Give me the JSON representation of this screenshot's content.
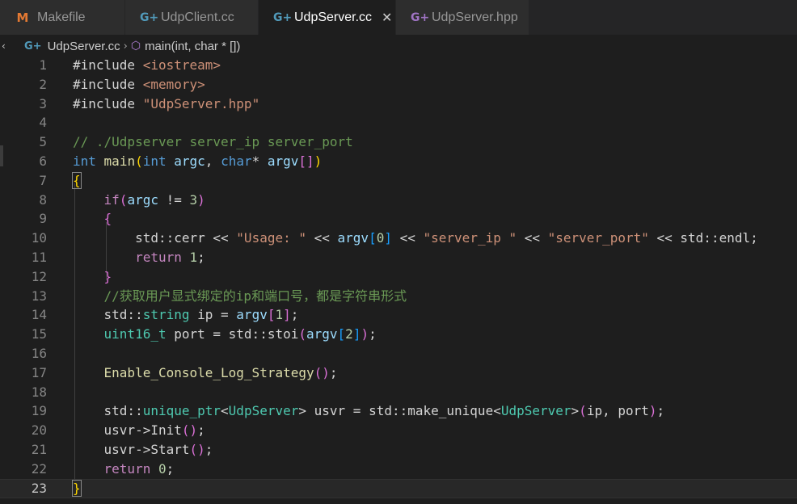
{
  "tabs": [
    {
      "label": "Makefile",
      "icon": "makefile-icon",
      "glyph": "M",
      "active": false
    },
    {
      "label": "UdpClient.cc",
      "icon": "cpp-file-icon",
      "glyph": "G+",
      "active": false
    },
    {
      "label": "UdpServer.cc",
      "icon": "cpp-file-icon",
      "glyph": "G+",
      "active": true
    },
    {
      "label": "UdpServer.hpp",
      "icon": "hpp-file-icon",
      "glyph": "G+",
      "active": false
    }
  ],
  "tab_close_glyph": "✕",
  "breadcrumb": {
    "file": "UdpServer.cc",
    "file_glyph": "G+",
    "separator": "›",
    "symbol": "main(int, char * [])",
    "symbol_glyph": "⬡"
  },
  "editor": {
    "current_line": 23,
    "lines": [
      {
        "n": 1,
        "segs": [
          [
            "pl",
            "#include "
          ],
          [
            "str",
            "<iostream>"
          ]
        ]
      },
      {
        "n": 2,
        "segs": [
          [
            "pl",
            "#include "
          ],
          [
            "str",
            "<memory>"
          ]
        ]
      },
      {
        "n": 3,
        "segs": [
          [
            "pl",
            "#include "
          ],
          [
            "str",
            "\"UdpServer.hpp\""
          ]
        ]
      },
      {
        "n": 4,
        "segs": []
      },
      {
        "n": 5,
        "segs": [
          [
            "cm",
            "// ./Udpserver server_ip server_port"
          ]
        ]
      },
      {
        "n": 6,
        "segs": [
          [
            "kw",
            "int"
          ],
          [
            "pl",
            " "
          ],
          [
            "fn",
            "main"
          ],
          [
            "p1",
            "("
          ],
          [
            "kw",
            "int"
          ],
          [
            "pl",
            " "
          ],
          [
            "var",
            "argc"
          ],
          [
            "pl",
            ", "
          ],
          [
            "kw",
            "char"
          ],
          [
            "pl",
            "* "
          ],
          [
            "var",
            "argv"
          ],
          [
            "p2",
            "[]"
          ],
          [
            "p1",
            ")"
          ]
        ]
      },
      {
        "n": 7,
        "segs": [
          [
            "p1 bm",
            "{"
          ]
        ]
      },
      {
        "n": 8,
        "segs": [
          [
            "pl",
            "    "
          ],
          [
            "ctl",
            "if"
          ],
          [
            "p2",
            "("
          ],
          [
            "var",
            "argc"
          ],
          [
            "pl",
            " != "
          ],
          [
            "num",
            "3"
          ],
          [
            "p2",
            ")"
          ]
        ]
      },
      {
        "n": 9,
        "segs": [
          [
            "pl",
            "    "
          ],
          [
            "p2",
            "{"
          ]
        ]
      },
      {
        "n": 10,
        "segs": [
          [
            "pl",
            "        std::cerr << "
          ],
          [
            "str",
            "\"Usage: \""
          ],
          [
            "pl",
            " << "
          ],
          [
            "var",
            "argv"
          ],
          [
            "p3",
            "["
          ],
          [
            "num",
            "0"
          ],
          [
            "p3",
            "]"
          ],
          [
            "pl",
            " << "
          ],
          [
            "str",
            "\"server_ip \""
          ],
          [
            "pl",
            " << "
          ],
          [
            "str",
            "\"server_port\""
          ],
          [
            "pl",
            " << std::endl;"
          ]
        ]
      },
      {
        "n": 11,
        "segs": [
          [
            "pl",
            "        "
          ],
          [
            "ctl",
            "return"
          ],
          [
            "pl",
            " "
          ],
          [
            "num",
            "1"
          ],
          [
            "pl",
            ";"
          ]
        ]
      },
      {
        "n": 12,
        "segs": [
          [
            "pl",
            "    "
          ],
          [
            "p2",
            "}"
          ]
        ]
      },
      {
        "n": 13,
        "segs": [
          [
            "pl",
            "    "
          ],
          [
            "cm",
            "//获取用户显式绑定的ip和端口号，都是字符串形式"
          ]
        ]
      },
      {
        "n": 14,
        "segs": [
          [
            "pl",
            "    std::"
          ],
          [
            "ty",
            "string"
          ],
          [
            "pl",
            " ip = "
          ],
          [
            "var",
            "argv"
          ],
          [
            "p2",
            "["
          ],
          [
            "num",
            "1"
          ],
          [
            "p2",
            "]"
          ],
          [
            "pl",
            ";"
          ]
        ]
      },
      {
        "n": 15,
        "segs": [
          [
            "pl",
            "    "
          ],
          [
            "ty",
            "uint16_t"
          ],
          [
            "pl",
            " port = std::stoi"
          ],
          [
            "p2",
            "("
          ],
          [
            "var",
            "argv"
          ],
          [
            "p3",
            "["
          ],
          [
            "num",
            "2"
          ],
          [
            "p3",
            "]"
          ],
          [
            "p2",
            ")"
          ],
          [
            "pl",
            ";"
          ]
        ]
      },
      {
        "n": 16,
        "segs": []
      },
      {
        "n": 17,
        "segs": [
          [
            "pl",
            "    "
          ],
          [
            "fn",
            "Enable_Console_Log_Strategy"
          ],
          [
            "p2",
            "()"
          ],
          [
            "pl",
            ";"
          ]
        ]
      },
      {
        "n": 18,
        "segs": []
      },
      {
        "n": 19,
        "segs": [
          [
            "pl",
            "    std::"
          ],
          [
            "ty",
            "unique_ptr"
          ],
          [
            "pl",
            "<"
          ],
          [
            "ty",
            "UdpServer"
          ],
          [
            "pl",
            "> usvr = std::make_unique<"
          ],
          [
            "ty",
            "UdpServer"
          ],
          [
            "pl",
            ">"
          ],
          [
            "p2",
            "("
          ],
          [
            "pl",
            "ip, port"
          ],
          [
            "p2",
            ")"
          ],
          [
            "pl",
            ";"
          ]
        ]
      },
      {
        "n": 20,
        "segs": [
          [
            "pl",
            "    usvr->Init"
          ],
          [
            "p2",
            "()"
          ],
          [
            "pl",
            ";"
          ]
        ]
      },
      {
        "n": 21,
        "segs": [
          [
            "pl",
            "    usvr->Start"
          ],
          [
            "p2",
            "()"
          ],
          [
            "pl",
            ";"
          ]
        ]
      },
      {
        "n": 22,
        "segs": [
          [
            "pl",
            "    "
          ],
          [
            "ctl",
            "return"
          ],
          [
            "pl",
            " "
          ],
          [
            "num",
            "0"
          ],
          [
            "pl",
            ";"
          ]
        ]
      },
      {
        "n": 23,
        "segs": [
          [
            "p1 bm",
            "}"
          ]
        ]
      }
    ]
  }
}
